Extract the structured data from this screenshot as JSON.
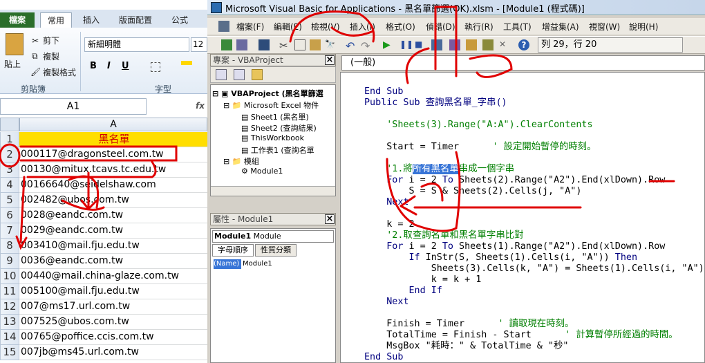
{
  "excel": {
    "file_tab": "檔案",
    "tabs": [
      "常用",
      "插入",
      "版面配置",
      "公式"
    ],
    "clipboard": {
      "paste": "貼上",
      "cut": "剪下",
      "copy": "複製",
      "format_painter": "複製格式",
      "group": "剪貼簿"
    },
    "font": {
      "name": "新細明體",
      "size": "12",
      "bold": "B",
      "italic": "I",
      "underline": "U",
      "group": "字型"
    },
    "name_box": "A1",
    "fx": "fx",
    "column_header": "A",
    "rows": [
      {
        "n": "1",
        "v": "黑名單"
      },
      {
        "n": "2",
        "v": "000117@dragonsteel.com.tw"
      },
      {
        "n": "3",
        "v": "00130@mitux.tcavs.tc.edu.tw"
      },
      {
        "n": "4",
        "v": "00166640@seidelshaw.com"
      },
      {
        "n": "5",
        "v": "002482@ubos.com.tw"
      },
      {
        "n": "6",
        "v": "0028@eandc.com.tw"
      },
      {
        "n": "7",
        "v": "0029@eandc.com.tw"
      },
      {
        "n": "8",
        "v": "003410@mail.fju.edu.tw"
      },
      {
        "n": "9",
        "v": "0036@eandc.com.tw"
      },
      {
        "n": "10",
        "v": "00440@mail.china-glaze.com.tw"
      },
      {
        "n": "11",
        "v": "005100@mail.fju.edu.tw"
      },
      {
        "n": "12",
        "v": "007@ms17.url.com.tw"
      },
      {
        "n": "13",
        "v": "007525@ubos.com.tw"
      },
      {
        "n": "14",
        "v": "00765@poffice.ccis.com.tw"
      },
      {
        "n": "15",
        "v": "007jb@ms45.url.com.tw"
      }
    ]
  },
  "vbe": {
    "title": "Microsoft Visual Basic for Applications - 黑名單篩選(OK).xlsm - [Module1 (程式碼)]",
    "menus": [
      "檔案(F)",
      "編輯(E)",
      "檢視(V)",
      "插入(I)",
      "格式(O)",
      "偵錯(D)",
      "執行(R)",
      "工具(T)",
      "增益集(A)",
      "視窗(W)",
      "說明(H)"
    ],
    "position": "列 29，行 20",
    "project_pane": {
      "title": "專案 - VBAProject",
      "root": "VBAProject (黑名單篩選",
      "excel_objects": "Microsoft Excel 物件",
      "items": [
        "Sheet1 (黑名單)",
        "Sheet2 (查詢結果)",
        "ThisWorkbook",
        "工作表1 (查詢名單"
      ],
      "modules": "模組",
      "module1": "Module1"
    },
    "props_pane": {
      "title": "屬性 - Module1",
      "object": "Module1",
      "object_type": "Module",
      "tab_alpha": "字母順序",
      "tab_cat": "性質分類",
      "name_key": "(Name)",
      "name_val": "Module1"
    },
    "combo": "(一般)",
    "code_lines": [
      {
        "t": "End Sub",
        "k": "kw"
      },
      {
        "t": "Public Sub 查詢黑名單_字串()",
        "k": "kw"
      },
      {
        "t": "",
        "k": ""
      },
      {
        "t": "    'Sheets(3).Range(\"A:A\").ClearContents",
        "k": "cm"
      },
      {
        "t": "",
        "k": ""
      },
      {
        "t": "    Start = Timer      ' 設定開始暫停的時刻。",
        "k": "mix"
      },
      {
        "t": "",
        "k": ""
      },
      {
        "t": "    '1.將所有黑名單串成一個字串",
        "k": "cm"
      },
      {
        "t": "    For i = 2 To Sheets(2).Range(\"A2\").End(xlDown).Row",
        "k": "for"
      },
      {
        "t": "        S = S & Sheets(2).Cells(j, \"A\")",
        "k": ""
      },
      {
        "t": "    Next",
        "k": "kw"
      },
      {
        "t": "",
        "k": ""
      },
      {
        "t": "    k = 2",
        "k": ""
      },
      {
        "t": "    '2.取查詢名單和黑名單字串比對",
        "k": "cm"
      },
      {
        "t": "    For i = 2 To Sheets(1).Range(\"A2\").End(xlDown).Row",
        "k": "for"
      },
      {
        "t": "        If InStr(S, Sheets(1).Cells(i, \"A\")) Then",
        "k": "if"
      },
      {
        "t": "            Sheets(3).Cells(k, \"A\") = Sheets(1).Cells(i, \"A\")",
        "k": ""
      },
      {
        "t": "            k = k + 1",
        "k": ""
      },
      {
        "t": "        End If",
        "k": "kw"
      },
      {
        "t": "    Next",
        "k": "kw"
      },
      {
        "t": "",
        "k": ""
      },
      {
        "t": "    Finish = Timer      ' 讀取現在時刻。",
        "k": "mix"
      },
      {
        "t": "    TotalTime = Finish - Start      ' 計算暫停所經過的時間。",
        "k": "mix"
      },
      {
        "t": "    MsgBox \"耗時：\" & TotalTime & \"秒\"",
        "k": ""
      },
      {
        "t": "End Sub",
        "k": "kw"
      }
    ]
  }
}
